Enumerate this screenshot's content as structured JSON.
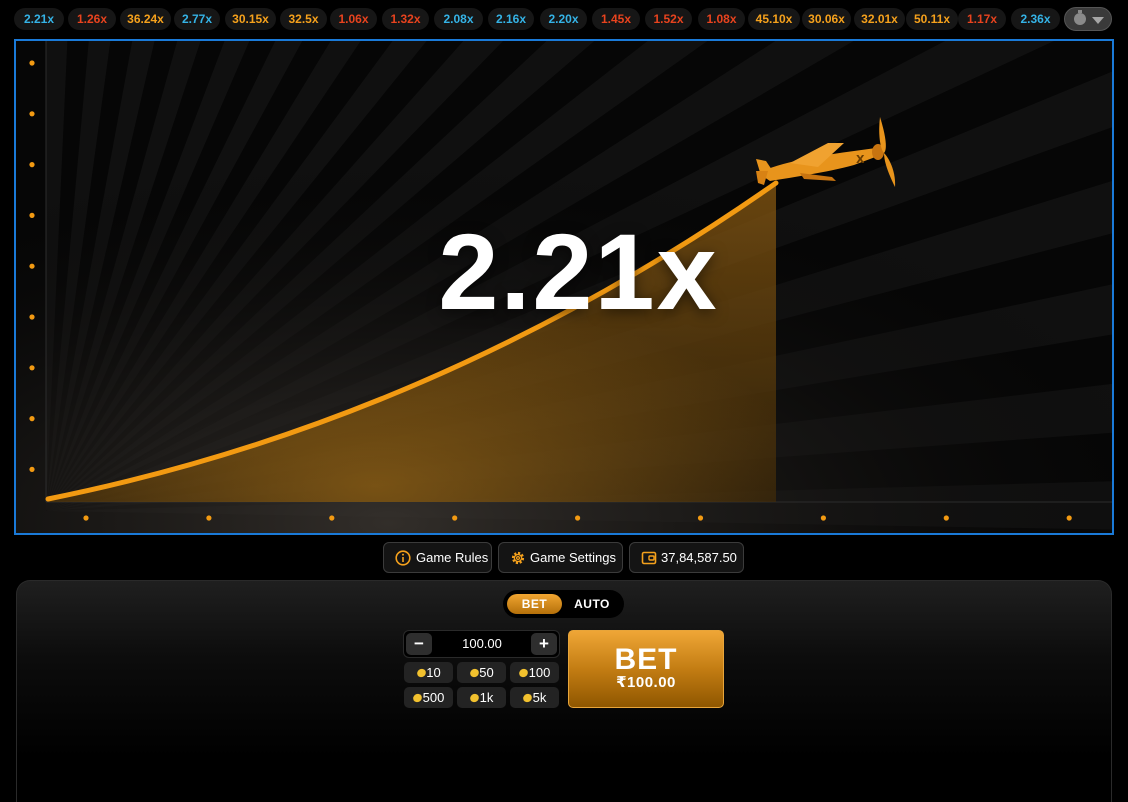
{
  "history": [
    {
      "value": "2.21x",
      "tone": "blue"
    },
    {
      "value": "1.26x",
      "tone": "red"
    },
    {
      "value": "36.24x",
      "tone": "orange"
    },
    {
      "value": "2.77x",
      "tone": "blue"
    },
    {
      "value": "30.15x",
      "tone": "orange"
    },
    {
      "value": "32.5x",
      "tone": "orange"
    },
    {
      "value": "1.06x",
      "tone": "red"
    },
    {
      "value": "1.32x",
      "tone": "red"
    },
    {
      "value": "2.08x",
      "tone": "blue"
    },
    {
      "value": "2.16x",
      "tone": "blue"
    },
    {
      "value": "2.20x",
      "tone": "blue"
    },
    {
      "value": "1.45x",
      "tone": "red"
    },
    {
      "value": "1.52x",
      "tone": "red"
    },
    {
      "value": "1.08x",
      "tone": "red"
    },
    {
      "value": "45.10x",
      "tone": "orange"
    },
    {
      "value": "30.06x",
      "tone": "orange"
    },
    {
      "value": "32.01x",
      "tone": "orange"
    },
    {
      "value": "50.11x",
      "tone": "orange"
    },
    {
      "value": "1.17x",
      "tone": "red"
    },
    {
      "value": "2.36x",
      "tone": "blue"
    }
  ],
  "history_toggle_icons": [
    "clock-icon",
    "chevron-down-icon"
  ],
  "game": {
    "multiplier": "2.21x",
    "plane_icon": "plane-icon",
    "curve_color": "#f29a12"
  },
  "info_bar": {
    "game_rules": "Game Rules",
    "game_settings": "Game Settings",
    "balance": "37,84,587.50"
  },
  "bet_panel": {
    "tabs": {
      "bet": "BET",
      "auto": "AUTO"
    },
    "active_tab": "BET",
    "minus": "−",
    "plus": "+",
    "amount": "100.00",
    "quick_amounts": [
      "10",
      "50",
      "100",
      "500",
      "1k",
      "5k"
    ],
    "bet_button": {
      "label": "BET",
      "amount": "₹100.00"
    }
  },
  "colors": {
    "blue": "#35b3e6",
    "orange": "#f5a11c",
    "red": "#e8431e",
    "accent": "#f29a12",
    "frame": "#1a7ad8"
  }
}
